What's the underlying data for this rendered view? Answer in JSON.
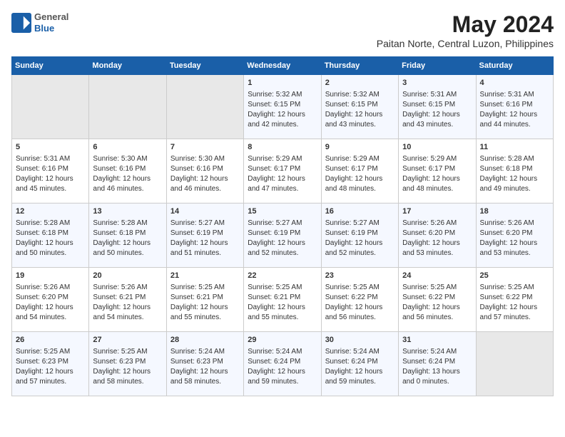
{
  "header": {
    "logo": {
      "line1": "General",
      "line2": "Blue"
    },
    "title": "May 2024",
    "subtitle": "Paitan Norte, Central Luzon, Philippines"
  },
  "days_of_week": [
    "Sunday",
    "Monday",
    "Tuesday",
    "Wednesday",
    "Thursday",
    "Friday",
    "Saturday"
  ],
  "weeks": [
    {
      "cells": [
        {
          "day": null,
          "info": null
        },
        {
          "day": null,
          "info": null
        },
        {
          "day": null,
          "info": null
        },
        {
          "day": "1",
          "info": "Sunrise: 5:32 AM\nSunset: 6:15 PM\nDaylight: 12 hours\nand 42 minutes."
        },
        {
          "day": "2",
          "info": "Sunrise: 5:32 AM\nSunset: 6:15 PM\nDaylight: 12 hours\nand 43 minutes."
        },
        {
          "day": "3",
          "info": "Sunrise: 5:31 AM\nSunset: 6:15 PM\nDaylight: 12 hours\nand 43 minutes."
        },
        {
          "day": "4",
          "info": "Sunrise: 5:31 AM\nSunset: 6:16 PM\nDaylight: 12 hours\nand 44 minutes."
        }
      ]
    },
    {
      "cells": [
        {
          "day": "5",
          "info": "Sunrise: 5:31 AM\nSunset: 6:16 PM\nDaylight: 12 hours\nand 45 minutes."
        },
        {
          "day": "6",
          "info": "Sunrise: 5:30 AM\nSunset: 6:16 PM\nDaylight: 12 hours\nand 46 minutes."
        },
        {
          "day": "7",
          "info": "Sunrise: 5:30 AM\nSunset: 6:16 PM\nDaylight: 12 hours\nand 46 minutes."
        },
        {
          "day": "8",
          "info": "Sunrise: 5:29 AM\nSunset: 6:17 PM\nDaylight: 12 hours\nand 47 minutes."
        },
        {
          "day": "9",
          "info": "Sunrise: 5:29 AM\nSunset: 6:17 PM\nDaylight: 12 hours\nand 48 minutes."
        },
        {
          "day": "10",
          "info": "Sunrise: 5:29 AM\nSunset: 6:17 PM\nDaylight: 12 hours\nand 48 minutes."
        },
        {
          "day": "11",
          "info": "Sunrise: 5:28 AM\nSunset: 6:18 PM\nDaylight: 12 hours\nand 49 minutes."
        }
      ]
    },
    {
      "cells": [
        {
          "day": "12",
          "info": "Sunrise: 5:28 AM\nSunset: 6:18 PM\nDaylight: 12 hours\nand 50 minutes."
        },
        {
          "day": "13",
          "info": "Sunrise: 5:28 AM\nSunset: 6:18 PM\nDaylight: 12 hours\nand 50 minutes."
        },
        {
          "day": "14",
          "info": "Sunrise: 5:27 AM\nSunset: 6:19 PM\nDaylight: 12 hours\nand 51 minutes."
        },
        {
          "day": "15",
          "info": "Sunrise: 5:27 AM\nSunset: 6:19 PM\nDaylight: 12 hours\nand 52 minutes."
        },
        {
          "day": "16",
          "info": "Sunrise: 5:27 AM\nSunset: 6:19 PM\nDaylight: 12 hours\nand 52 minutes."
        },
        {
          "day": "17",
          "info": "Sunrise: 5:26 AM\nSunset: 6:20 PM\nDaylight: 12 hours\nand 53 minutes."
        },
        {
          "day": "18",
          "info": "Sunrise: 5:26 AM\nSunset: 6:20 PM\nDaylight: 12 hours\nand 53 minutes."
        }
      ]
    },
    {
      "cells": [
        {
          "day": "19",
          "info": "Sunrise: 5:26 AM\nSunset: 6:20 PM\nDaylight: 12 hours\nand 54 minutes."
        },
        {
          "day": "20",
          "info": "Sunrise: 5:26 AM\nSunset: 6:21 PM\nDaylight: 12 hours\nand 54 minutes."
        },
        {
          "day": "21",
          "info": "Sunrise: 5:25 AM\nSunset: 6:21 PM\nDaylight: 12 hours\nand 55 minutes."
        },
        {
          "day": "22",
          "info": "Sunrise: 5:25 AM\nSunset: 6:21 PM\nDaylight: 12 hours\nand 55 minutes."
        },
        {
          "day": "23",
          "info": "Sunrise: 5:25 AM\nSunset: 6:22 PM\nDaylight: 12 hours\nand 56 minutes."
        },
        {
          "day": "24",
          "info": "Sunrise: 5:25 AM\nSunset: 6:22 PM\nDaylight: 12 hours\nand 56 minutes."
        },
        {
          "day": "25",
          "info": "Sunrise: 5:25 AM\nSunset: 6:22 PM\nDaylight: 12 hours\nand 57 minutes."
        }
      ]
    },
    {
      "cells": [
        {
          "day": "26",
          "info": "Sunrise: 5:25 AM\nSunset: 6:23 PM\nDaylight: 12 hours\nand 57 minutes."
        },
        {
          "day": "27",
          "info": "Sunrise: 5:25 AM\nSunset: 6:23 PM\nDaylight: 12 hours\nand 58 minutes."
        },
        {
          "day": "28",
          "info": "Sunrise: 5:24 AM\nSunset: 6:23 PM\nDaylight: 12 hours\nand 58 minutes."
        },
        {
          "day": "29",
          "info": "Sunrise: 5:24 AM\nSunset: 6:24 PM\nDaylight: 12 hours\nand 59 minutes."
        },
        {
          "day": "30",
          "info": "Sunrise: 5:24 AM\nSunset: 6:24 PM\nDaylight: 12 hours\nand 59 minutes."
        },
        {
          "day": "31",
          "info": "Sunrise: 5:24 AM\nSunset: 6:24 PM\nDaylight: 13 hours\nand 0 minutes."
        },
        {
          "day": null,
          "info": null
        }
      ]
    }
  ]
}
